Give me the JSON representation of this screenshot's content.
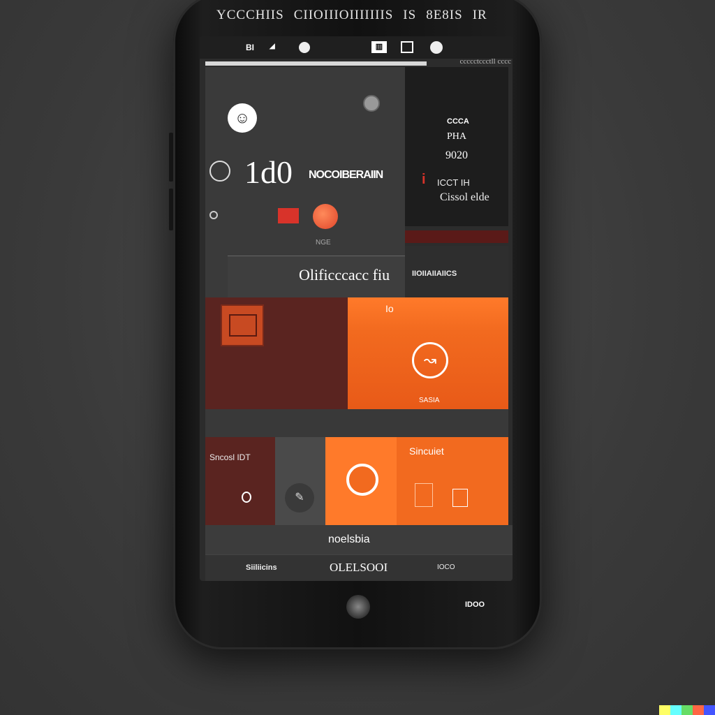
{
  "device": {
    "top_label": [
      "YCCCHIIS",
      "CIIOIIIOIIIIIIIS",
      "IS",
      "8E8IS",
      "IR"
    ]
  },
  "status_bar": {
    "left_text": "BI",
    "tray_icons": [
      "calendar-icon",
      "grid-icon",
      "alarm-icon"
    ]
  },
  "progress": {
    "label": "ccccctccctll cccc",
    "value": 0.72
  },
  "main_panel": {
    "big_value": "1d0",
    "title": "NOCOIBERAIIN",
    "small_label": "NGE",
    "sub_label": "Olificccacc fiu"
  },
  "side_panel": {
    "label1": "CCCA",
    "label2": "PHA",
    "value": "9020",
    "accent_label": "i",
    "line1": "ICCT IH",
    "line2": "Cissol elde",
    "bottom_label": "IIOIIAIIAIICS"
  },
  "tiles": {
    "large_orange_label": "Io",
    "large_orange_caption": "SASIA",
    "orange_label": "Sincuiet",
    "dark_red_label": "Sncosl IDT"
  },
  "footer": {
    "title": "noelsbia",
    "left": "Siiliicins",
    "center": "OLELSOOI",
    "right": "IOCO"
  },
  "home": {
    "right_label": "IDOO"
  },
  "colors": {
    "orange": "#f26a1f",
    "orange_light": "#ff7a2a",
    "dark_red": "#5a2420",
    "accent_red": "#d8332a"
  }
}
